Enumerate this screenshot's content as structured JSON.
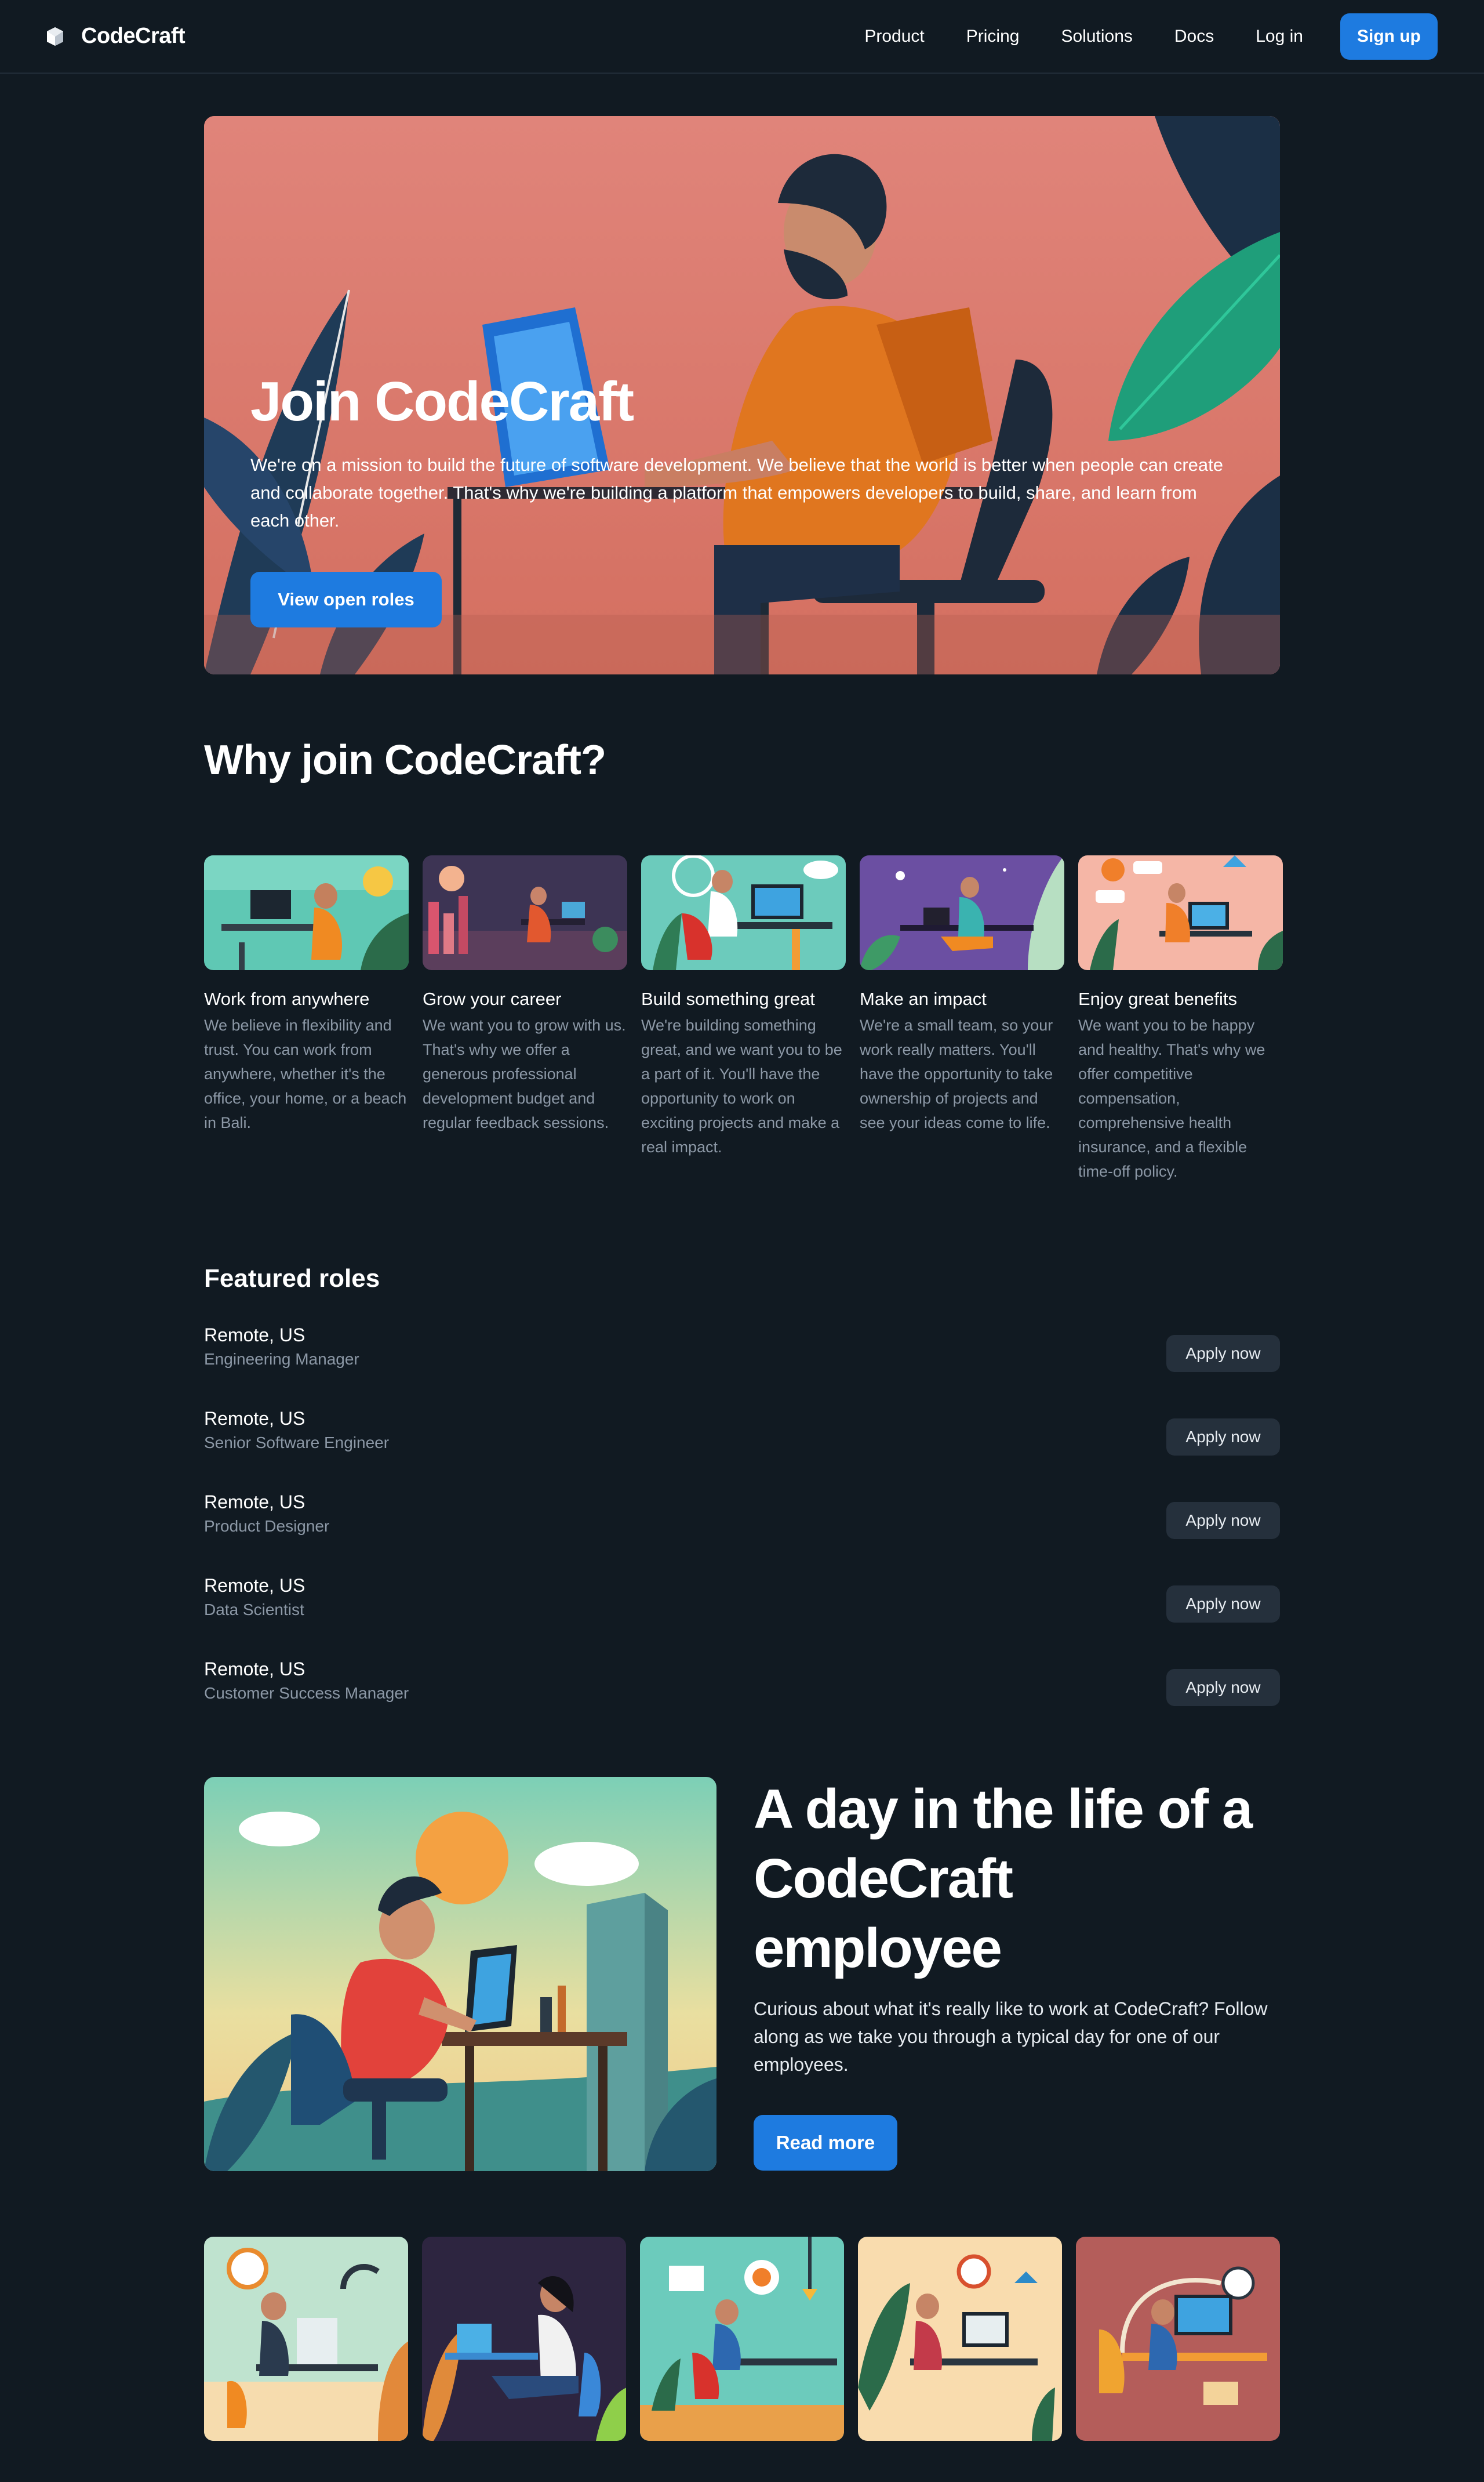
{
  "colors": {
    "background": "#111a22",
    "accent": "#1e7be0",
    "muted_text": "#8c98a6",
    "secondary_button": "#25303c"
  },
  "nav": {
    "logo_icon": "cube-icon",
    "brand": "CodeCraft",
    "links": [
      "Product",
      "Pricing",
      "Solutions",
      "Docs",
      "Log in"
    ],
    "signup": "Sign up"
  },
  "hero": {
    "title": "Join CodeCraft",
    "text": "We're on a mission to build the future of software development. We believe that the world is better when people can create and collaborate together. That's why we're building a platform that empowers developers to build, share, and learn from each other.",
    "button": "View open roles"
  },
  "why": {
    "title": "Why join CodeCraft?",
    "cards": [
      {
        "title": "Work from anywhere",
        "text": "We believe in flexibility and trust. You can work from anywhere, whether it's the office, your home, or a beach in Bali."
      },
      {
        "title": "Grow your career",
        "text": "We want you to grow with us. That's why we offer a generous professional development budget and regular feedback sessions."
      },
      {
        "title": "Build something great",
        "text": "We're building something great, and we want you to be a part of it. You'll have the opportunity to work on exciting projects and make a real impact."
      },
      {
        "title": "Make an impact",
        "text": "We're a small team, so your work really matters. You'll have the opportunity to take ownership of projects and see your ideas come to life."
      },
      {
        "title": "Enjoy great benefits",
        "text": "We want you to be happy and healthy. That's why we offer competitive compensation, comprehensive health insurance, and a flexible time-off policy."
      }
    ]
  },
  "roles": {
    "title": "Featured roles",
    "apply_label": "Apply now",
    "items": [
      {
        "location": "Remote, US",
        "title": "Engineering Manager"
      },
      {
        "location": "Remote, US",
        "title": "Senior Software Engineer"
      },
      {
        "location": "Remote, US",
        "title": "Product Designer"
      },
      {
        "location": "Remote, US",
        "title": "Data Scientist"
      },
      {
        "location": "Remote, US",
        "title": "Customer Success Manager"
      }
    ]
  },
  "day": {
    "title": "A day in the life of a CodeCraft employee",
    "text": "Curious about what it's really like to work at CodeCraft? Follow along as we take you through a typical day for one of our employees.",
    "button": "Read more"
  }
}
